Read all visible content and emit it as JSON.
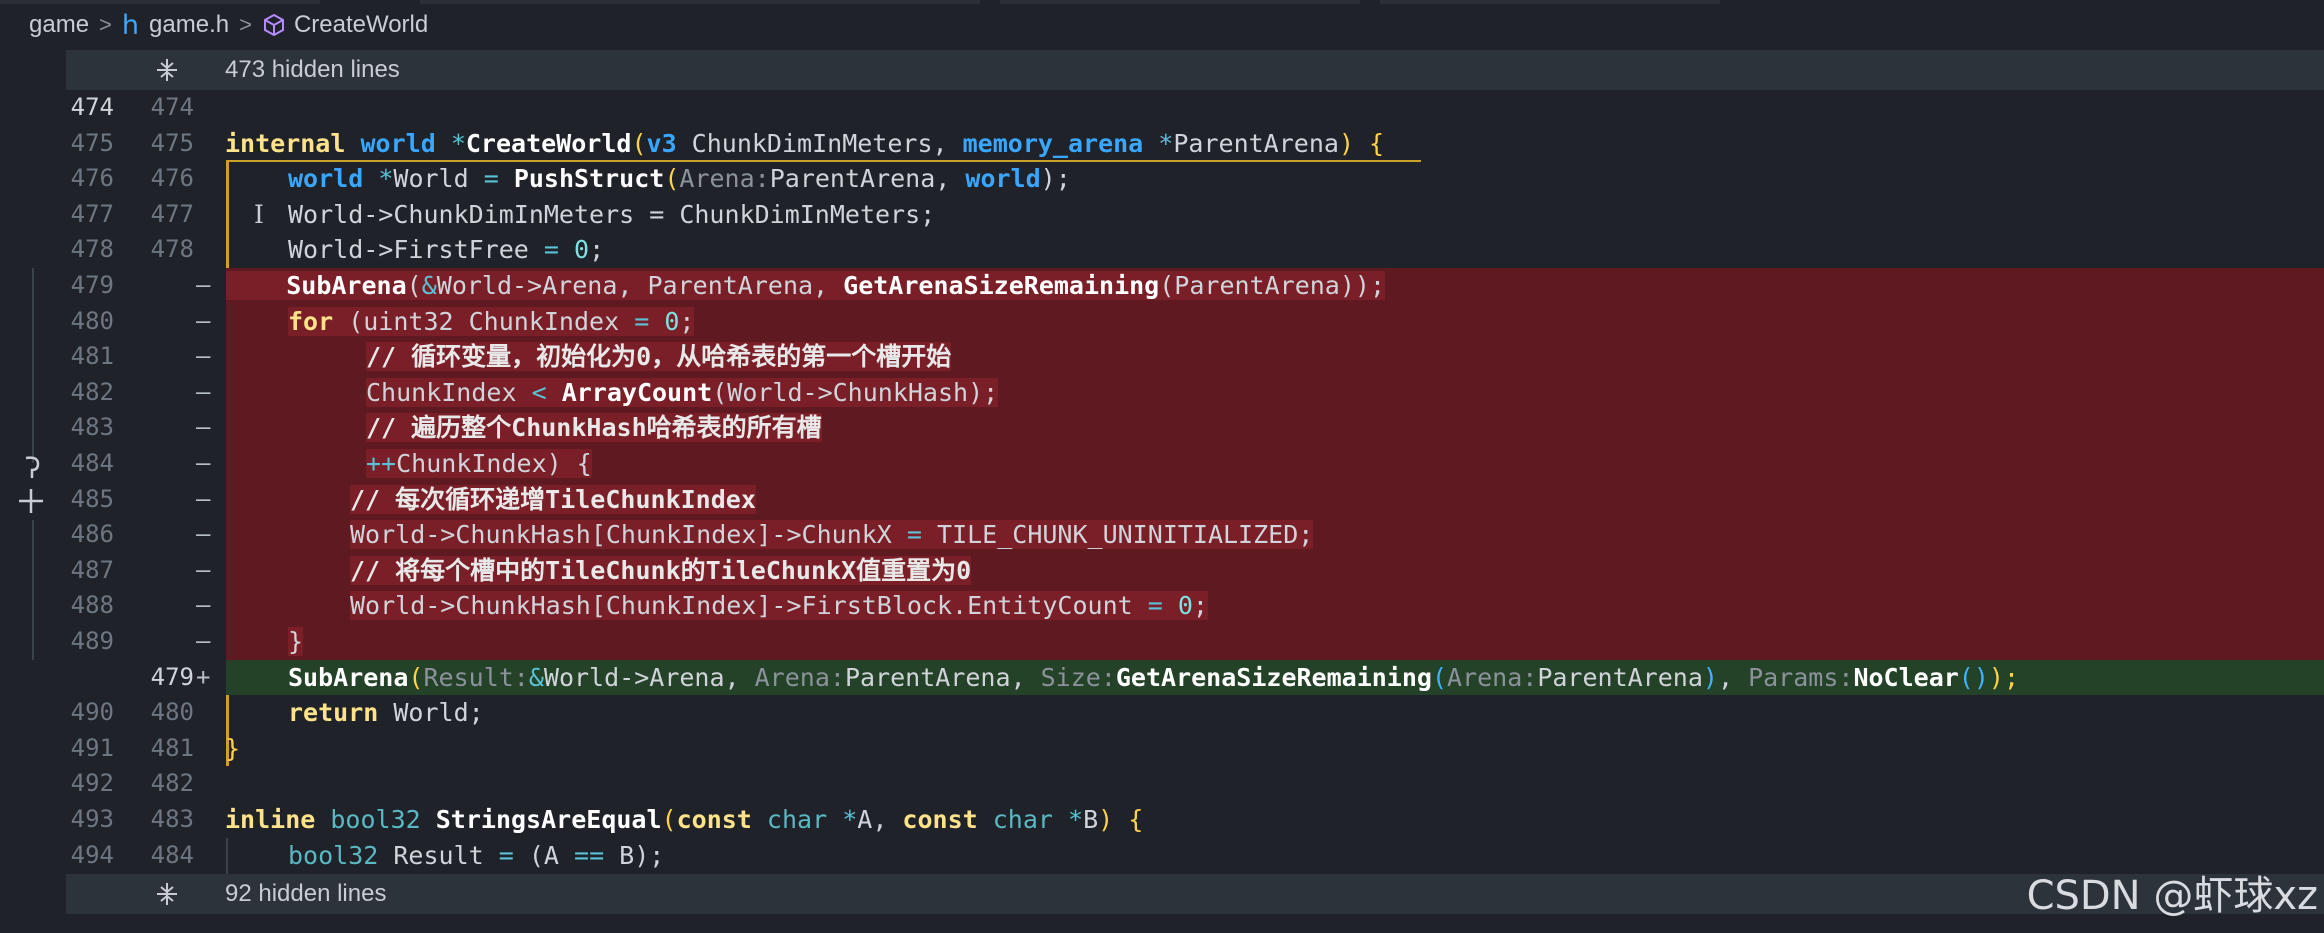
{
  "breadcrumb": {
    "folder": "game",
    "file": "game.h",
    "symbol": "CreateWorld"
  },
  "hidden_top": {
    "label": "473 hidden lines"
  },
  "hidden_bottom": {
    "label": "92 hidden lines"
  },
  "lines": [
    {
      "l1": "474",
      "l2": "474",
      "marker": ""
    },
    {
      "l1": "475",
      "l2": "475",
      "marker": ""
    },
    {
      "l1": "476",
      "l2": "476",
      "marker": ""
    },
    {
      "l1": "477",
      "l2": "477",
      "marker": ""
    },
    {
      "l1": "478",
      "l2": "478",
      "marker": ""
    },
    {
      "l1": "479",
      "l2": "",
      "marker": "—"
    },
    {
      "l1": "480",
      "l2": "",
      "marker": "—"
    },
    {
      "l1": "481",
      "l2": "",
      "marker": "—"
    },
    {
      "l1": "482",
      "l2": "",
      "marker": "—"
    },
    {
      "l1": "483",
      "l2": "",
      "marker": "—"
    },
    {
      "l1": "484",
      "l2": "",
      "marker": "—"
    },
    {
      "l1": "485",
      "l2": "",
      "marker": "—"
    },
    {
      "l1": "486",
      "l2": "",
      "marker": "—"
    },
    {
      "l1": "487",
      "l2": "",
      "marker": "—"
    },
    {
      "l1": "488",
      "l2": "",
      "marker": "—"
    },
    {
      "l1": "489",
      "l2": "",
      "marker": "—"
    },
    {
      "l1": "",
      "l2": "479",
      "marker": "+"
    },
    {
      "l1": "490",
      "l2": "480",
      "marker": ""
    },
    {
      "l1": "491",
      "l2": "481",
      "marker": ""
    },
    {
      "l1": "492",
      "l2": "482",
      "marker": ""
    },
    {
      "l1": "493",
      "l2": "483",
      "marker": ""
    },
    {
      "l1": "494",
      "l2": "484",
      "marker": ""
    }
  ],
  "code": {
    "l475": {
      "internal": "internal",
      "world": "world",
      "star1": "*",
      "name": "CreateWorld",
      "open": "(",
      "v3": "v3",
      "p1": " ChunkDimInMeters, ",
      "arena": "memory_arena",
      "star2": "*",
      "p2": "ParentArena",
      "close": ")",
      "brace": " {"
    },
    "l476": {
      "world": "world",
      "star": "*",
      "lhs": "World ",
      "eq": "=",
      "fn": "PushStruct",
      "open": "(",
      "hint": "Arena:",
      "arg": "ParentArena, ",
      "world2": "world",
      "close": ");"
    },
    "l477": {
      "text": "World->ChunkDimInMeters = ChunkDimInMeters;"
    },
    "l478": {
      "lhs": "World->FirstFree ",
      "eq": "=",
      "num": "0",
      "end": ";"
    },
    "l479": {
      "fn": "SubArena",
      "open": "(",
      "amp": "&",
      "a1": "World->Arena, ParentArena, ",
      "fn2": "GetArenaSizeRemaining",
      "a2": "(ParentArena));"
    },
    "l480": {
      "for": "for",
      "mid": " (uint32 ChunkIndex ",
      "eq": "=",
      "num": "0",
      "end": ";"
    },
    "l481": {
      "text": "// 循环变量，初始化为0，从哈希表的第一个槽开始"
    },
    "l482": {
      "a": "ChunkIndex ",
      "lt": "<",
      "fn": "ArrayCount",
      "b": "(World->ChunkHash);"
    },
    "l483": {
      "text": "// 遍历整个ChunkHash哈希表的所有槽"
    },
    "l484": {
      "pp": "++",
      "text": "ChunkIndex) {"
    },
    "l485": {
      "text": "// 每次循环递增TileChunkIndex"
    },
    "l486": {
      "a": "World->ChunkHash[ChunkIndex]->ChunkX ",
      "eq": "=",
      "b": " TILE_CHUNK_UNINITIALIZED;"
    },
    "l487": {
      "text": "// 将每个槽中的TileChunk的TileChunkX值重置为0"
    },
    "l488": {
      "a": "World->ChunkHash[ChunkIndex]->FirstBlock.EntityCount ",
      "eq": "=",
      "num": "0",
      "end": ";"
    },
    "l489": {
      "text": "}"
    },
    "ladd": {
      "fn": "SubArena",
      "open": "(",
      "h1": "Result:",
      "amp": "&",
      "a1": "World->Arena, ",
      "h2": "Arena:",
      "a2": "ParentArena, ",
      "h3": "Size:",
      "fn2": "GetArenaSizeRemaining",
      "open2": "(",
      "h4": "Arena:",
      "a3": "ParentArena",
      "close2": ")",
      "a4": ", ",
      "h5": "Params:",
      "fn3": "NoClear",
      "call": "()",
      "end": ");"
    },
    "l490": {
      "ret": "return",
      "text": " World;"
    },
    "l491": {
      "text": "}"
    },
    "l493": {
      "inline": "inline",
      "ty": "bool32",
      "name": "StringsAreEqual",
      "open": "(",
      "const1": "const",
      "char1": "char",
      "star1": "*",
      "a": "A, ",
      "const2": "const",
      "char2": "char",
      "star2": "*",
      "b": "B",
      "close": ")",
      "brace": " {"
    },
    "l494": {
      "ty": "bool32",
      "a": " Result ",
      "eq": "=",
      "b": " (A ",
      "eqeq": "==",
      "c": " B);"
    }
  },
  "watermark": "CSDN @虾球xz",
  "colors": {
    "background": "#1f2329",
    "deleted": "#5e1a20",
    "added": "#244227",
    "keyword": "#ffe38a",
    "type": "#39a6ff"
  }
}
